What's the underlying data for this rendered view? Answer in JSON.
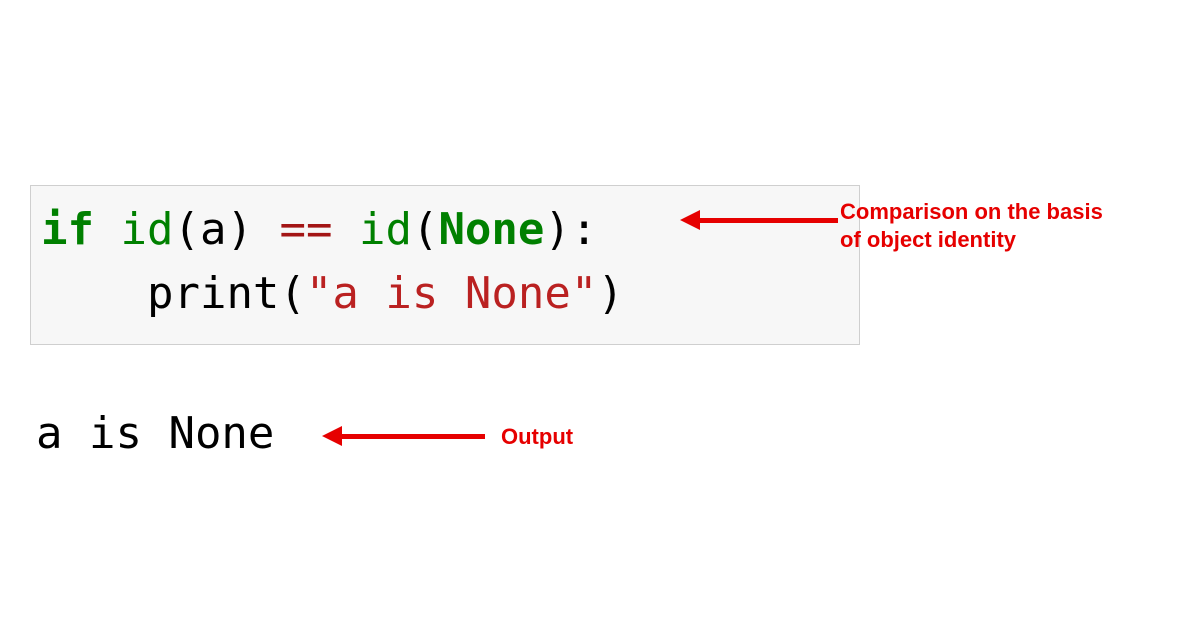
{
  "code": {
    "line1": {
      "if": "if",
      "space1": " ",
      "id1": "id",
      "lparen1": "(",
      "a1": "a",
      "rparen1": ")",
      "space2": " ",
      "eq": "==",
      "space3": " ",
      "id2": "id",
      "lparen2": "(",
      "none": "None",
      "rparen2": ")",
      "colon": ":"
    },
    "line2": {
      "indent": "    ",
      "print": "print",
      "lparen": "(",
      "string": "\"a is None\"",
      "rparen": ")"
    }
  },
  "output": "a is None",
  "annotations": {
    "comparison_line1": "Comparison on the basis",
    "comparison_line2": "of object identity",
    "output_label": "Output"
  }
}
